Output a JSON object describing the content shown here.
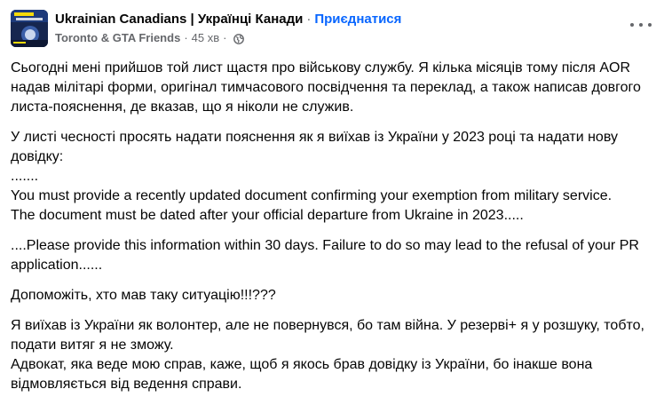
{
  "header": {
    "group_name": "Ukrainian Canadians | Українці Канади",
    "separator": "·",
    "join_label": "Приєднатися",
    "author": "Toronto & GTA Friends",
    "time": "45 хв",
    "audience_icon": "globe-icon"
  },
  "post": {
    "paragraphs": [
      "Сьогодні мені прийшов той лист щастя про військову службу. Я кілька місяців тому після AOR\nнадав мілітарі форми, оригінал тимчасового посвідчення та переклад, а також написав довгого\nлиста-пояснення, де вказав, що я ніколи не служив.",
      "У листі чесності просять надати пояснення як я виїхав із України у 2023 році та надати нову\nдовідку:\n.......\nYou must provide a recently updated document confirming your exemption from military service.\nThe document must be dated after your official departure from Ukraine in 2023.....",
      "....Please provide this information within 30 days. Failure to do so may lead to the refusal of your PR\napplication......",
      "Допоможіть, хто мав таку ситуацію!!!???",
      "Я виїхав із України як волонтер, але не повернувся, бо там війна. У резерві+ я у розшуку, тобто,\nподати витяг я не зможу.\nАдвокат, яка веде мою справ, каже, щоб я якось брав довідку із України, бо інакше вона\nвідмовляється від ведення справи."
    ]
  },
  "colors": {
    "link": "#0866ff",
    "secondary_text": "#65676b",
    "primary_text": "#050505",
    "avatar_bg": "#16264f"
  }
}
